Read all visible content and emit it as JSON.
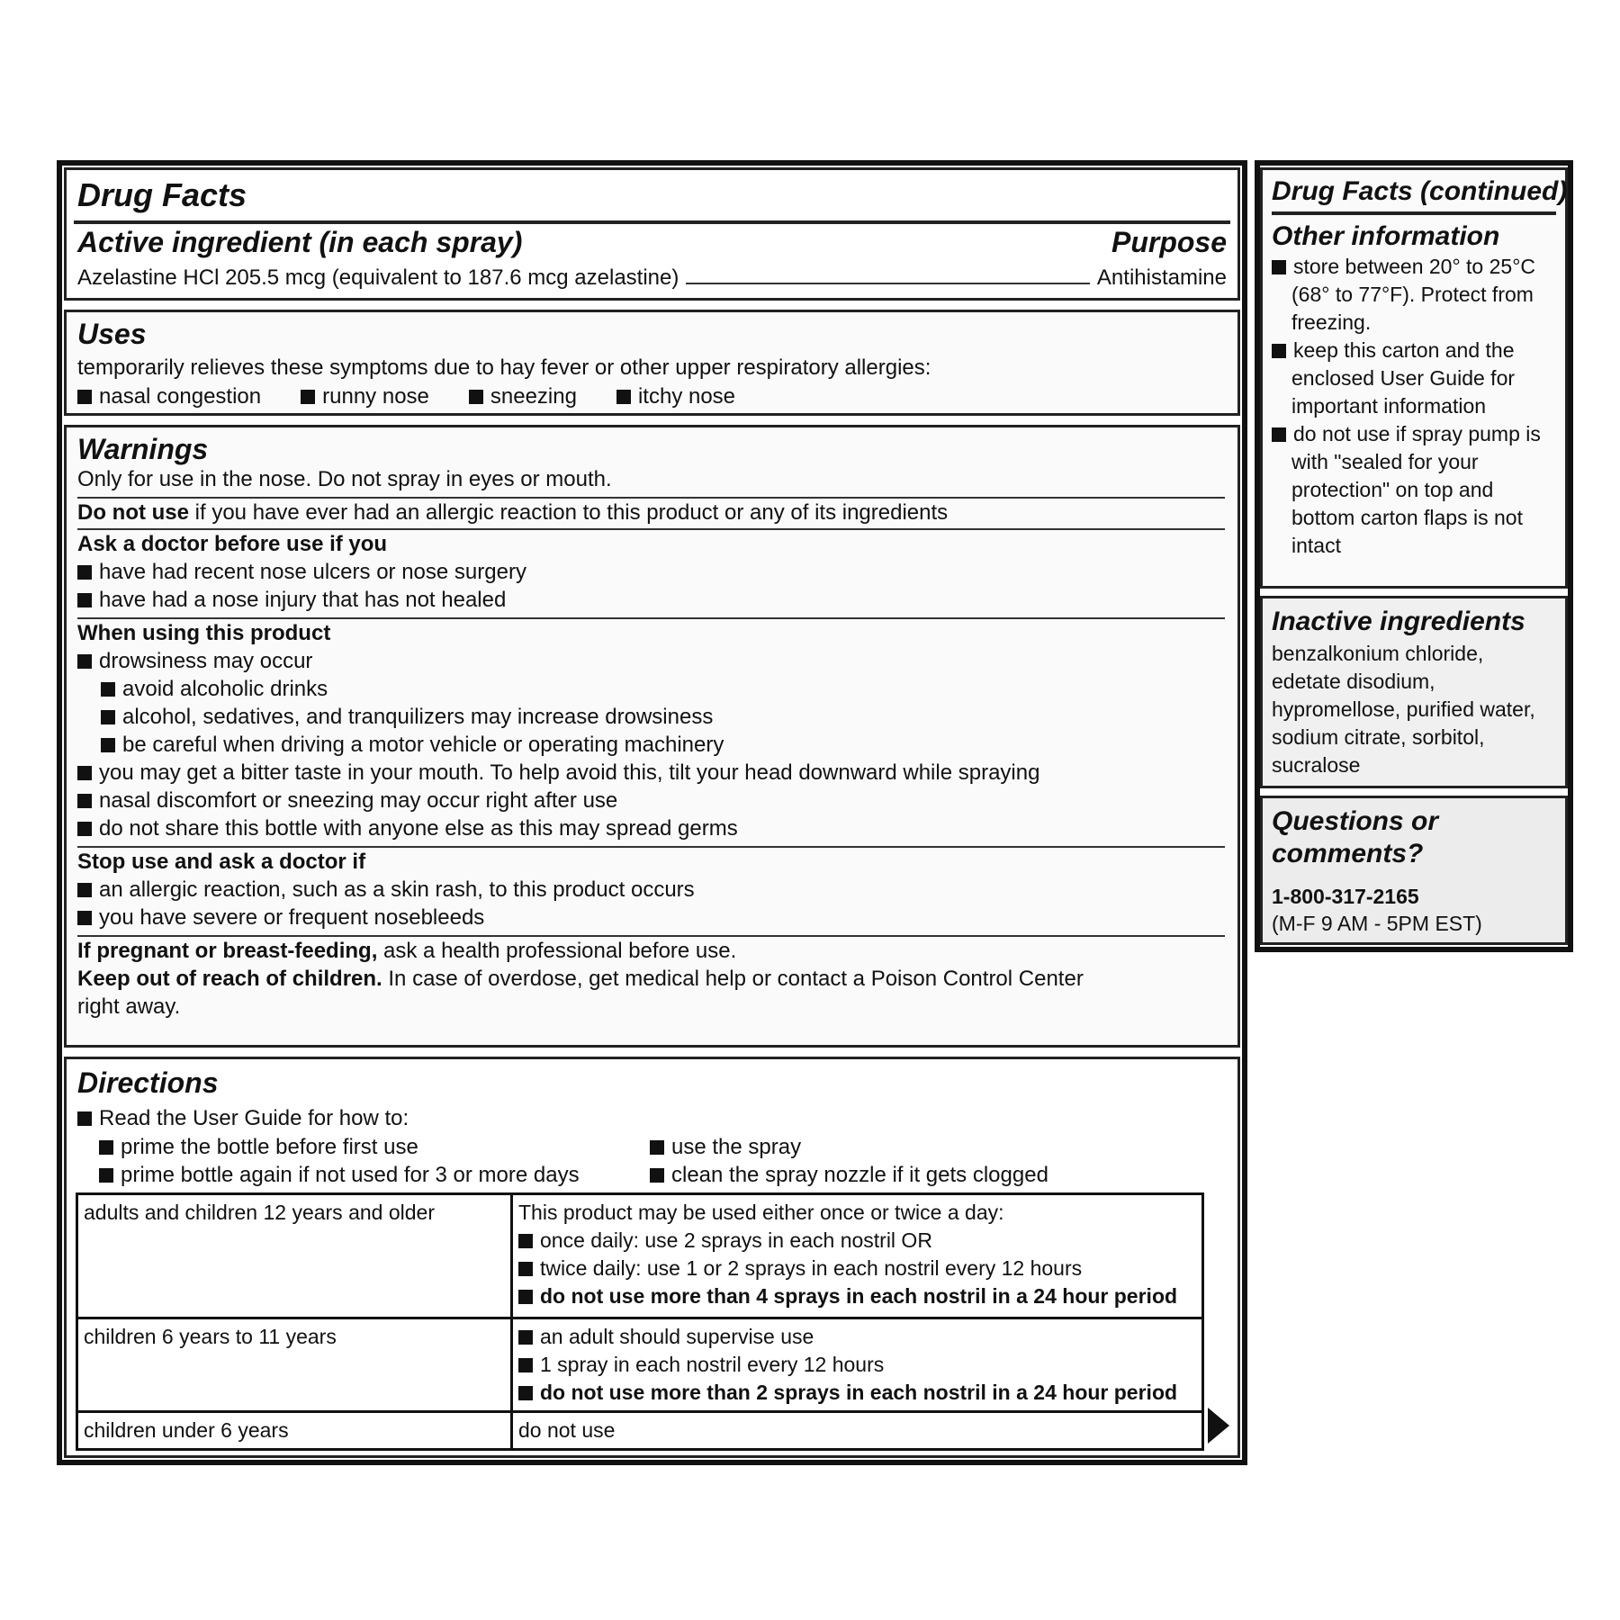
{
  "main": {
    "header": {
      "title": "Drug Facts"
    },
    "active": {
      "heading": "Active ingredient (in each spray)",
      "purpose_label": "Purpose",
      "ingredient_text": "Azelastine HCl 205.5 mcg (equivalent to 187.6 mcg azelastine)",
      "purpose_value": "Antihistamine"
    },
    "uses": {
      "heading": "Uses",
      "intro": "temporarily relieves these symptoms due to hay fever or other upper respiratory allergies:",
      "items": [
        "nasal congestion",
        "runny nose",
        "sneezing",
        "itchy nose"
      ]
    },
    "warnings": {
      "heading": "Warnings",
      "intro": "Only for use in the nose. Do not spray in eyes or mouth.",
      "do_not_use_bold": "Do not use",
      "do_not_use_text": " if you have ever had an allergic reaction to this product or any of its ingredients",
      "ask_doctor_heading": "Ask a doctor before use if you",
      "ask_doctor_items": [
        "have had recent nose ulcers or nose surgery",
        "have had a nose injury that has not healed"
      ],
      "when_using_heading": "When using this product",
      "when_using_items": [
        "drowsiness may occur",
        "you may get a bitter taste in your mouth. To help avoid this, tilt your head downward while spraying",
        "nasal discomfort or sneezing may occur right after use",
        "do not share this bottle with anyone else as this may spread germs"
      ],
      "drowsy_subitems": [
        "avoid alcoholic drinks",
        "alcohol, sedatives, and tranquilizers may increase drowsiness",
        "be careful when driving a motor vehicle or operating machinery"
      ],
      "stop_heading": "Stop use and ask a doctor if",
      "stop_items": [
        "an allergic reaction, such as a skin rash, to this product occurs",
        "you have severe or frequent nosebleeds"
      ],
      "pregnant_bold": "If pregnant or breast-feeding,",
      "pregnant_text": " ask a health professional before use.",
      "keep_out_bold": "Keep out of reach of children.",
      "keep_out_text": " In case of overdose, get medical help or contact a Poison Control Center",
      "keep_out_text2": "right away."
    },
    "directions": {
      "heading": "Directions",
      "intro": "Read the User Guide for how to:",
      "guide_left": [
        "prime the bottle before first use",
        "prime bottle again if not used for 3 or more days"
      ],
      "guide_right": [
        "use the spray",
        "clean the spray nozzle if it gets clogged"
      ],
      "rows": [
        {
          "group": "adults and children 12 years and older",
          "lead": "This product may be used either once or twice a day:",
          "items": [
            "once daily: use 2 sprays in each nostril OR",
            "twice daily: use 1 or 2 sprays in each nostril every 12 hours",
            "do not use more than 4 sprays in each nostril in a 24 hour period"
          ]
        },
        {
          "group": "children 6 years to 11 years",
          "lead": "",
          "items": [
            "an adult should supervise use",
            "1 spray in each nostril every 12 hours",
            "do not use more than 2 sprays in each nostril in a 24 hour period"
          ]
        },
        {
          "group": "children under 6 years",
          "lead": "do not use",
          "items": []
        }
      ]
    }
  },
  "side": {
    "title": "Drug Facts (continued)",
    "other": {
      "heading": "Other information",
      "items": [
        "store between 20° to 25°C (68° to 77°F). Protect from freezing.",
        "keep this carton and the enclosed User Guide for important information",
        "do not use if spray pump is with \"sealed for your protection\" on top and bottom carton flaps is not intact"
      ]
    },
    "inactive": {
      "heading": "Inactive ingredients",
      "text": "benzalkonium chloride, edetate disodium, hypromellose, purified water, sodium citrate, sorbitol, sucralose"
    },
    "questions": {
      "heading": "Questions or comments?",
      "phone": "1-800-317-2165",
      "hours": "(M-F 9 AM - 5PM EST)"
    }
  },
  "colors": {
    "border": "#111111",
    "text": "#111111",
    "background": "#ffffff"
  },
  "icons": {
    "bullet": "square-bullet-icon",
    "continue": "continue-arrow-icon"
  }
}
